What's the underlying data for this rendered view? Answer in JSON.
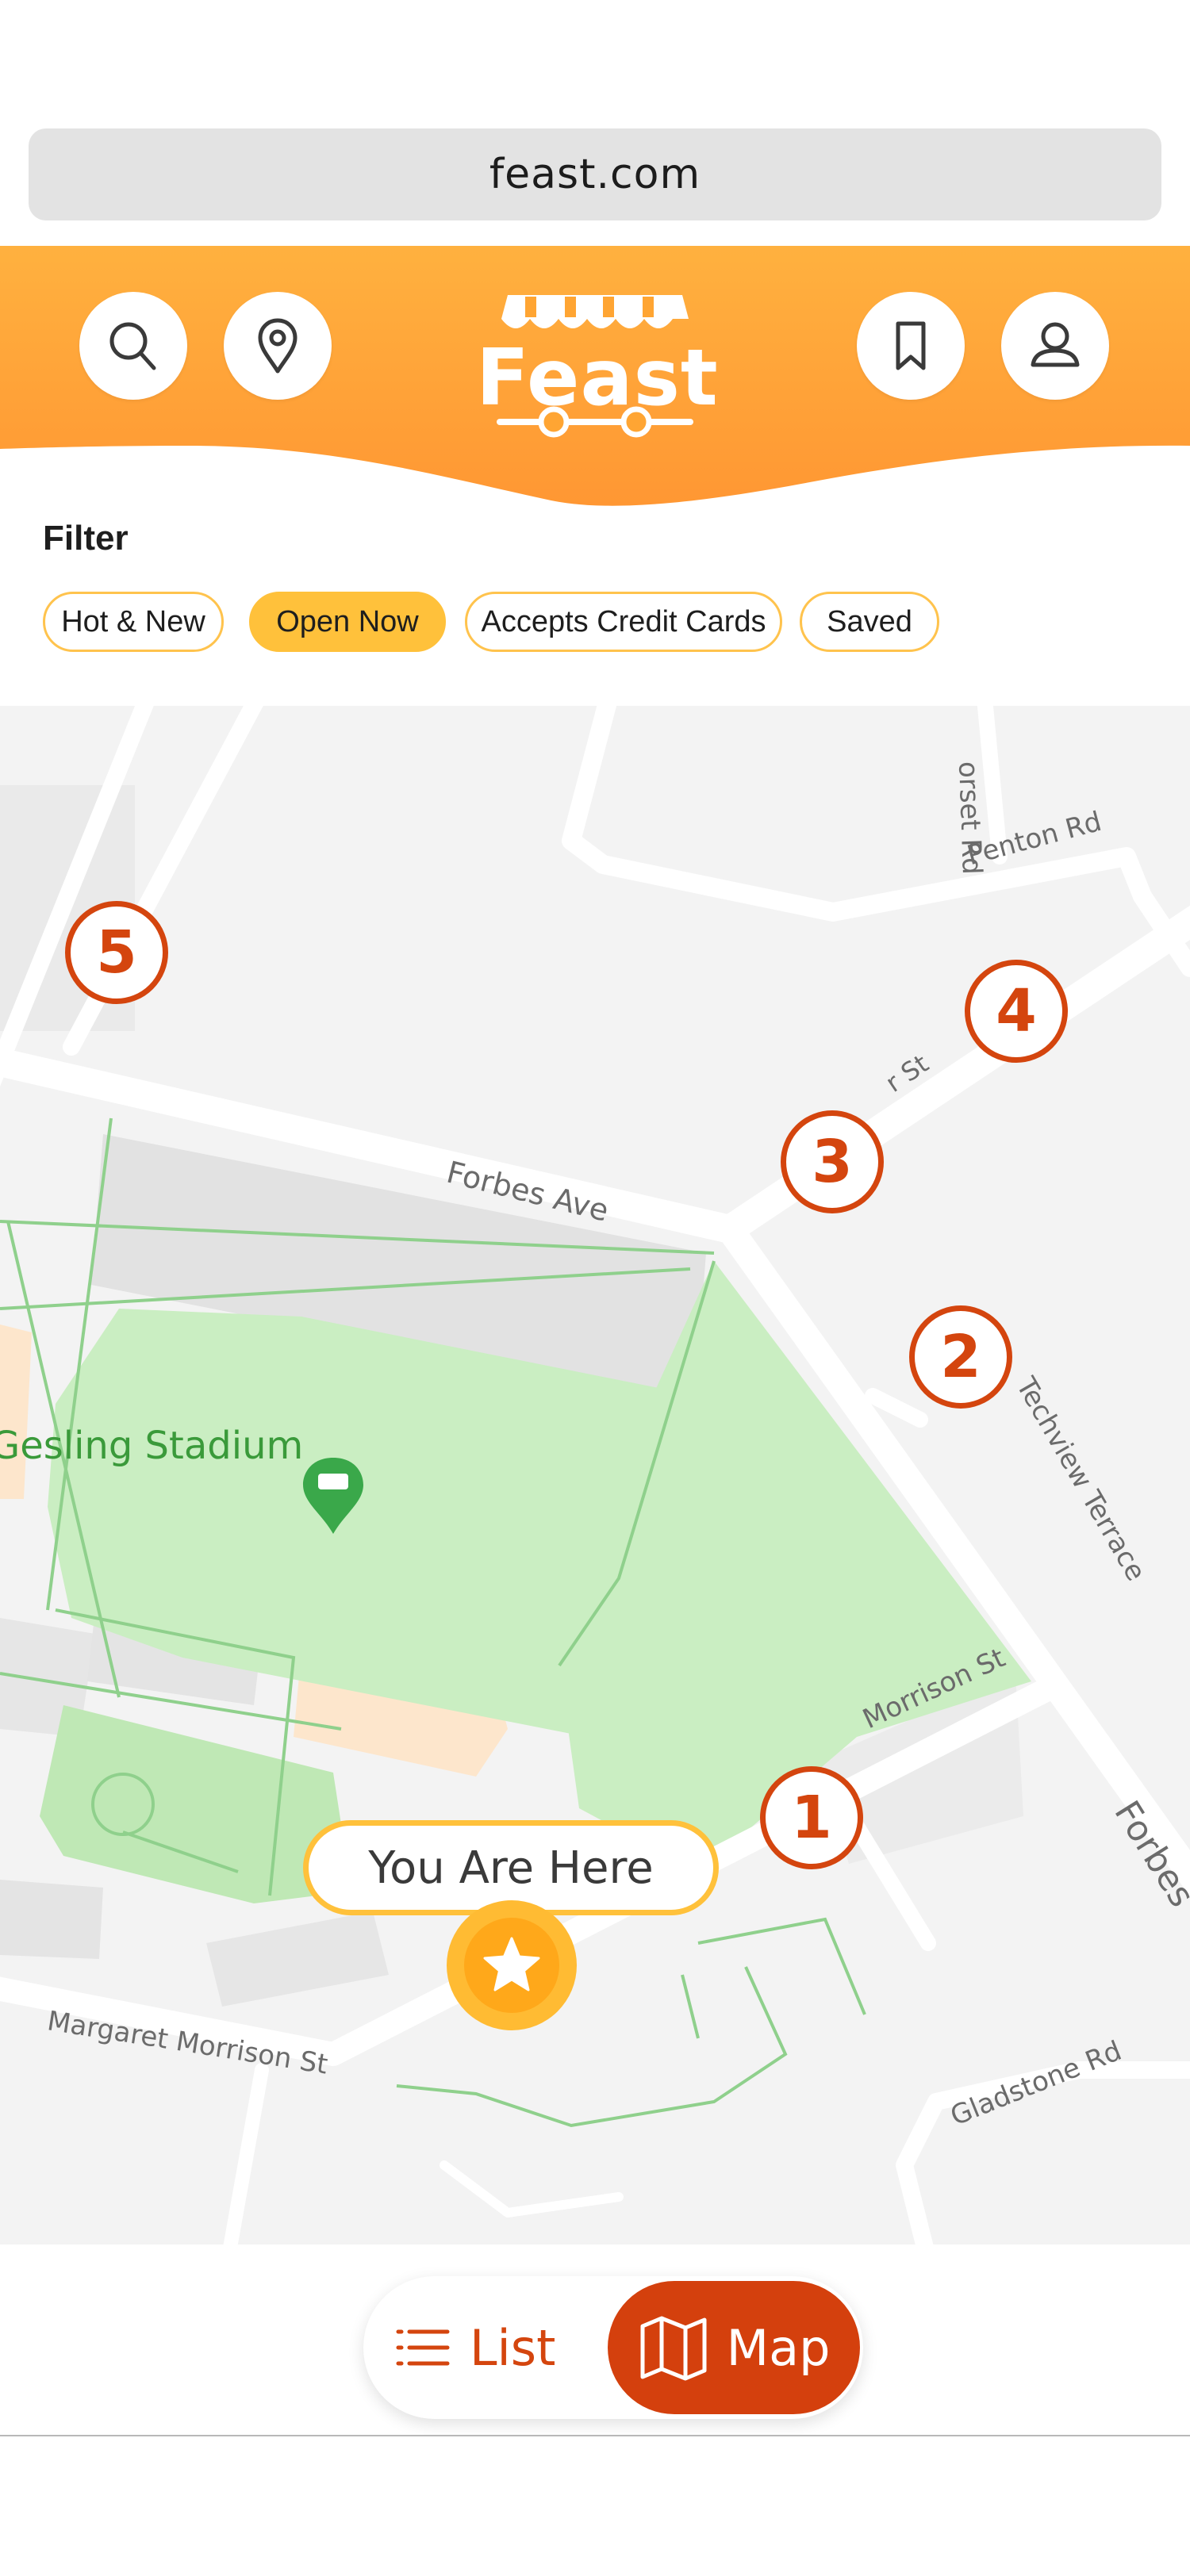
{
  "browser": {
    "url": "feast.com"
  },
  "header": {
    "logo_text": "Feast",
    "brand_color": "#ffa533",
    "icons": [
      "search-icon",
      "location-pin-icon",
      "bookmark-icon",
      "user-icon"
    ]
  },
  "filter": {
    "title": "Filter",
    "chips": [
      {
        "label": "Hot & New",
        "active": false
      },
      {
        "label": "Open Now",
        "active": true
      },
      {
        "label": "Accepts Credit Cards",
        "active": false
      },
      {
        "label": "Saved",
        "active": false
      }
    ]
  },
  "map": {
    "streets": {
      "forbes_ave": "Forbes Ave",
      "forbes_partial": "Forbes",
      "penton_rd": "Penton Rd",
      "dorset_rd": "orset Rd",
      "techview_terrace": "Techview Terrace",
      "margaret_morrison_1": "Margaret Morrison St",
      "margaret_morrison_2": "Morrison St",
      "gladstone_rd": "Gladstone Rd",
      "tech_st": "r St"
    },
    "landmark": "Gesling Stadium",
    "markers": [
      "1",
      "2",
      "3",
      "4",
      "5"
    ],
    "you_are_here": "You Are Here",
    "accent_color": "#d4450e"
  },
  "view_toggle": {
    "list_label": "List",
    "map_label": "Map",
    "selected": "Map"
  }
}
